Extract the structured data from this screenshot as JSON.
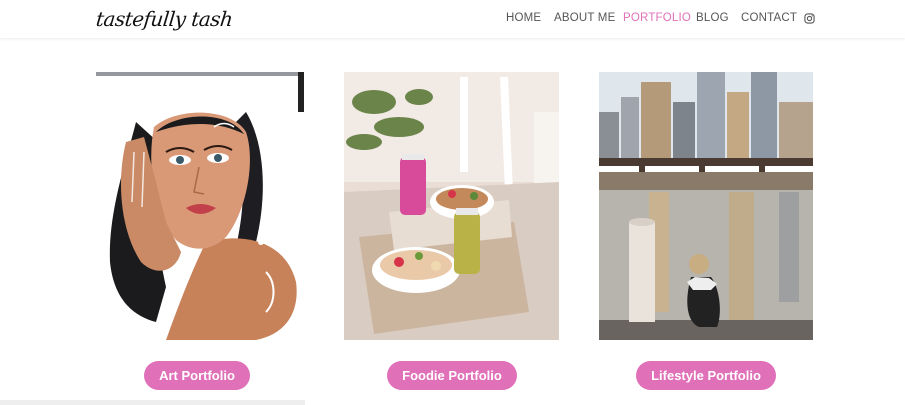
{
  "site": {
    "logo_text": "tastefully tash"
  },
  "nav": {
    "items": [
      {
        "label": "HOME"
      },
      {
        "label": "ABOUT ME"
      },
      {
        "label": "PORTFOLIO"
      },
      {
        "label": "BLOG"
      },
      {
        "label": "CONTACT"
      }
    ],
    "active_label": "PORTFOLIO",
    "social_icon": "instagram-icon"
  },
  "cards": [
    {
      "button_label": "Art Portfolio",
      "image": "painted-woman-portrait"
    },
    {
      "button_label": "Foodie Portfolio",
      "image": "smoothie-bowls-table"
    },
    {
      "button_label": "Lifestyle Portfolio",
      "image": "city-waterfront-girl"
    }
  ],
  "colors": {
    "accent": "#e070b8",
    "nav_text": "#555555"
  }
}
